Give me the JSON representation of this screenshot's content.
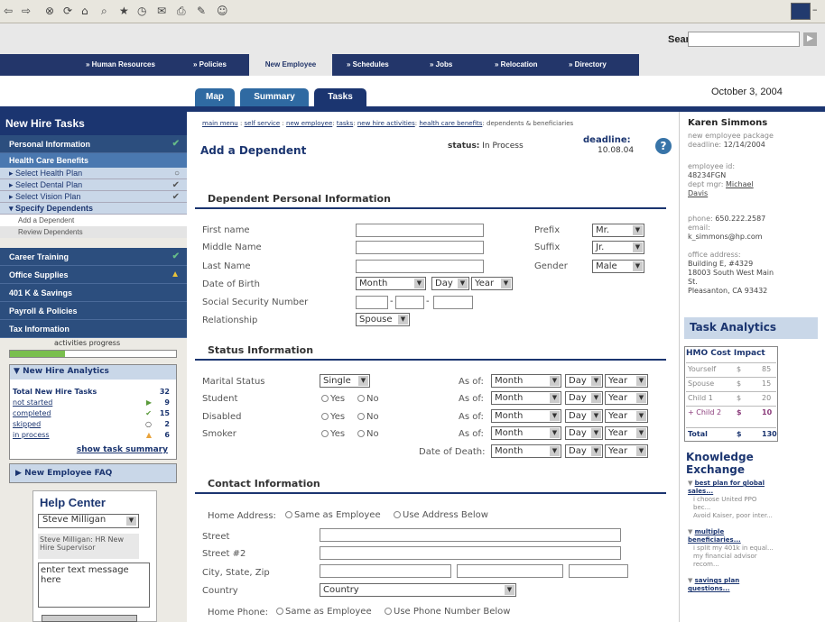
{
  "search": {
    "label": "Search:"
  },
  "nav": {
    "items": [
      "» Human Resources",
      "» Policies",
      "New Employee",
      "» Schedules",
      "» Jobs",
      "» Relocation",
      "» Directory"
    ]
  },
  "tabs": [
    "Map",
    "Summary",
    "Tasks"
  ],
  "date": "October 3, 2004",
  "sidebar": {
    "title": "New Hire Tasks",
    "items": [
      {
        "label": "Personal Information"
      },
      {
        "label": "Health Care Benefits"
      },
      {
        "label": "Select Health Plan"
      },
      {
        "label": "Select Dental Plan"
      },
      {
        "label": "Select Vision Plan"
      },
      {
        "label": "Specify Dependents"
      },
      {
        "label": "Add a Dependent"
      },
      {
        "label": "Review Dependents"
      },
      {
        "label": "Career Training"
      },
      {
        "label": "Office Supplies"
      },
      {
        "label": "401 K & Savings"
      },
      {
        "label": "Payroll & Policies"
      },
      {
        "label": "Tax Information"
      }
    ],
    "progress_label": "activities progress",
    "progress_value": 0.33
  },
  "analytics": {
    "title": "New Hire Analytics",
    "rows": [
      {
        "label": "Total New Hire Tasks",
        "value": "32"
      },
      {
        "label": "not started",
        "value": "9"
      },
      {
        "label": "completed",
        "value": "15"
      },
      {
        "label": "skipped",
        "value": "2"
      },
      {
        "label": "in process",
        "value": "6"
      }
    ],
    "show_summary": "show task summary"
  },
  "faq": "New Employee FAQ",
  "help": {
    "title": "Help Center",
    "selected": "Steve Milligan",
    "info": "Steve Milligan: HR New Hire Supervisor",
    "message": "enter text message here"
  },
  "breadcrumb": {
    "links": [
      "main menu",
      "self service",
      "new employee",
      "tasks",
      "new hire activities",
      "health care benefits"
    ],
    "current": "dependents & beneficiaries"
  },
  "form": {
    "title": "Add a Dependent",
    "status_label": "status:",
    "status_value": "In Process",
    "deadline_label": "deadline:",
    "deadline_value": "10.08.04",
    "personal": {
      "heading": "Dependent Personal Information",
      "first_name": "First name",
      "middle_name": "Middle Name",
      "last_name": "Last Name",
      "dob": "Date of Birth",
      "ssn": "Social Security Number",
      "relationship": "Relationship",
      "prefix": "Prefix",
      "suffix": "Suffix",
      "gender": "Gender",
      "prefix_val": "Mr.",
      "suffix_val": "Jr.",
      "gender_val": "Male",
      "month": "Month",
      "day": "Day",
      "year": "Year",
      "relationship_val": "Spouse"
    },
    "status_info": {
      "heading": "Status Information",
      "marital": "Marital Status",
      "marital_val": "Single",
      "student": "Student",
      "disabled": "Disabled",
      "smoker": "Smoker",
      "yes": "Yes",
      "no": "No",
      "as_of": "As of:",
      "date_of_death": "Date of Death:"
    },
    "contact": {
      "heading": "Contact Information",
      "home_address": "Home Address:",
      "same_as_employee": "Same as Employee",
      "use_address_below": "Use Address Below",
      "street": "Street",
      "street2": "Street #2",
      "city": "City, State, Zip",
      "country": "Country",
      "country_val": "Country",
      "home_phone": "Home Phone:",
      "use_phone_below": "Use Phone Number Below"
    }
  },
  "employee": {
    "name": "Karen Simmons",
    "pkg_label": "new employee package",
    "deadline_label": "deadline:",
    "deadline": "12/14/2004",
    "id_label": "employee id:",
    "id": "48234FGN",
    "mgr_label": "dept mgr:",
    "mgr_first": "Michael",
    "mgr_last": "Davis",
    "phone_label": "phone:",
    "phone": "650.222.2587",
    "email_label": "email:",
    "email": "k_simmons@hp.com",
    "office_label": "office address:",
    "office1": "Building E, #4329",
    "office2": "18003 South West Main",
    "office3": "St.",
    "office4": "Pleasanton, CA 93432"
  },
  "task_analytics": {
    "title": "Task Analytics",
    "hmo_title": "HMO Cost Impact",
    "rows": [
      {
        "label": "Yourself",
        "cur": "$",
        "val": "85"
      },
      {
        "label": "Spouse",
        "cur": "$",
        "val": "15"
      },
      {
        "label": "Child 1",
        "cur": "$",
        "val": "20"
      },
      {
        "label": "+ Child 2",
        "cur": "$",
        "val": "10"
      },
      {
        "label": "Total",
        "cur": "$",
        "val": "130"
      }
    ]
  },
  "knowledge": {
    "title": "Knowledge Exchange",
    "items": [
      {
        "link": "best plan for global sales...",
        "lines": [
          "i choose United PPO bec...",
          "Avoid Kaiser, poor inter..."
        ]
      },
      {
        "link": "multiple beneficiaries...",
        "lines": [
          "i split my 401k in equal...",
          "my financial advisor recom..."
        ]
      },
      {
        "link": "savings plan questions...",
        "lines": []
      }
    ]
  }
}
